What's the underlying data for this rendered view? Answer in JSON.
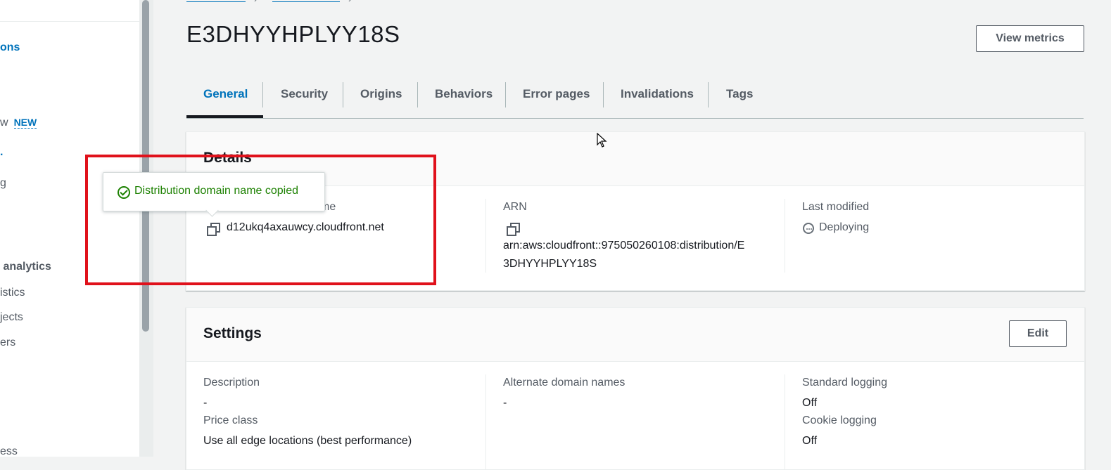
{
  "sidebar": {
    "items": [
      {
        "text": "ons",
        "style": "link"
      },
      {
        "text": "w",
        "style": "text",
        "badge": "NEW"
      },
      {
        "text": "g",
        "style": "text"
      },
      {
        "text": "analytics",
        "style": "heading"
      },
      {
        "text": "istics",
        "style": "text"
      },
      {
        "text": "jects",
        "style": "text"
      },
      {
        "text": "ers",
        "style": "text"
      },
      {
        "text": "ess",
        "style": "text"
      }
    ]
  },
  "page": {
    "title": "E3DHYYHPLYY18S",
    "view_metrics_label": "View metrics"
  },
  "tabs": [
    {
      "label": "General",
      "active": true
    },
    {
      "label": "Security"
    },
    {
      "label": "Origins"
    },
    {
      "label": "Behaviors"
    },
    {
      "label": "Error pages"
    },
    {
      "label": "Invalidations"
    },
    {
      "label": "Tags"
    }
  ],
  "details": {
    "title": "Details",
    "domain_label_visible": "me",
    "domain_value": "d12ukq4axauwcy.cloudfront.net",
    "arn_label": "ARN",
    "arn_value_line1": "arn:aws:cloudfront::975050260108:distribution/E",
    "arn_value_line2": "3DHYYHPLYY18S",
    "last_modified_label": "Last modified",
    "last_modified_value": "Deploying"
  },
  "popover": {
    "message": "Distribution domain name copied"
  },
  "settings": {
    "title": "Settings",
    "edit_label": "Edit",
    "description_label": "Description",
    "description_value": "-",
    "price_class_label": "Price class",
    "price_class_value": "Use all edge locations (best performance)",
    "alternate_domains_label": "Alternate domain names",
    "alternate_domains_value": "-",
    "standard_logging_label": "Standard logging",
    "standard_logging_value": "Off",
    "cookie_logging_label": "Cookie logging",
    "cookie_logging_value": "Off"
  },
  "colors": {
    "link": "#0073bb",
    "success": "#1d8102",
    "annotation": "#e0111b"
  }
}
